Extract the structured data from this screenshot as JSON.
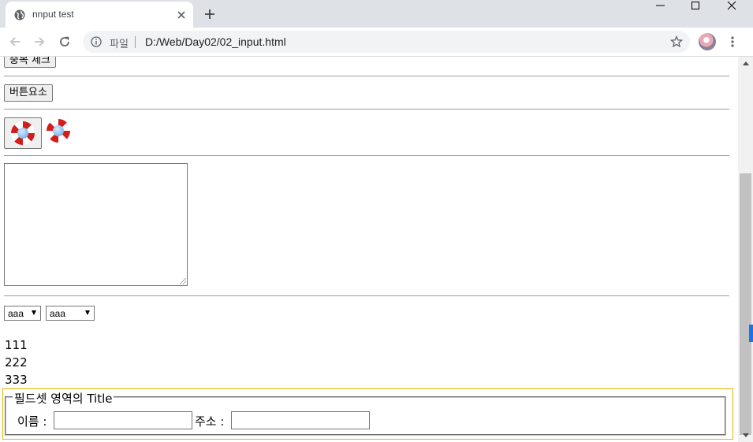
{
  "browser": {
    "tab_title": "nnput test",
    "scheme_label": "파일",
    "url": "D:/Web/Day02/02_input.html"
  },
  "page": {
    "top_button": "중복 체크",
    "button_element": "버튼요소",
    "select1_value": "aaa",
    "select2_value": "aaa",
    "lines": [
      "111",
      "222",
      "333"
    ],
    "fieldset_legend": "필드셋 영역의 Title",
    "name_label": "이름 :",
    "name_value": "",
    "address_label": "주소 :",
    "address_value": ""
  }
}
